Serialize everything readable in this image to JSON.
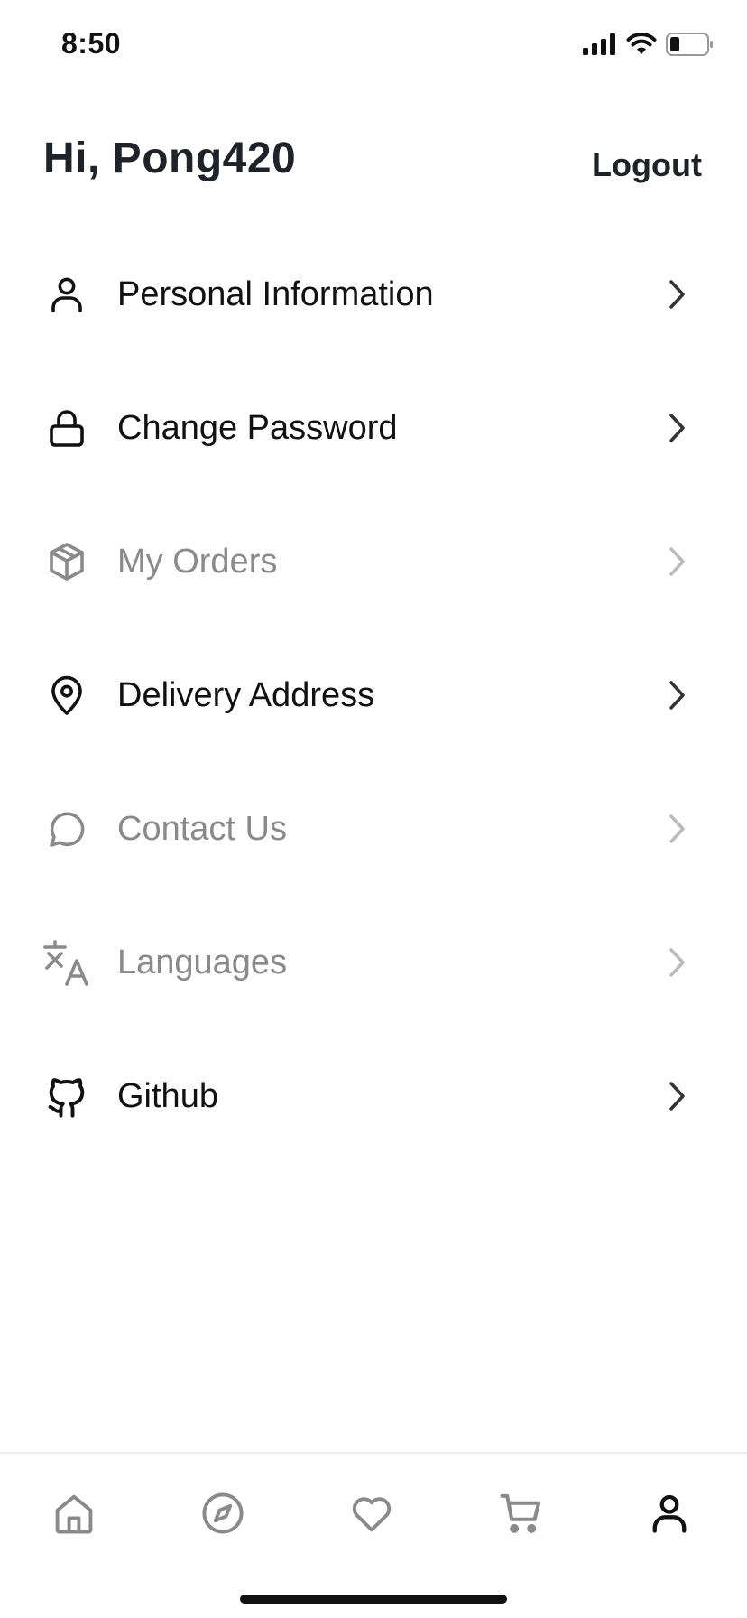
{
  "status_bar": {
    "time": "8:50"
  },
  "header": {
    "greeting": "Hi, Pong420",
    "logout_label": "Logout"
  },
  "menu": {
    "items": [
      {
        "label": "Personal Information",
        "icon": "user-icon",
        "enabled": true
      },
      {
        "label": "Change Password",
        "icon": "lock-icon",
        "enabled": true
      },
      {
        "label": "My Orders",
        "icon": "box-icon",
        "enabled": false
      },
      {
        "label": "Delivery Address",
        "icon": "map-pin-icon",
        "enabled": true
      },
      {
        "label": "Contact Us",
        "icon": "chat-icon",
        "enabled": false
      },
      {
        "label": "Languages",
        "icon": "translate-icon",
        "enabled": false
      },
      {
        "label": "Github",
        "icon": "github-icon",
        "enabled": true
      }
    ]
  },
  "tab_bar": {
    "tabs": [
      {
        "icon": "home-icon"
      },
      {
        "icon": "compass-icon"
      },
      {
        "icon": "heart-icon"
      },
      {
        "icon": "cart-icon"
      },
      {
        "icon": "user-icon",
        "active": true
      }
    ]
  },
  "colors": {
    "active": "#111111",
    "disabled": "#8a8a8a",
    "heading": "#1f2329",
    "inactive_tab": "#8a8a8a"
  }
}
